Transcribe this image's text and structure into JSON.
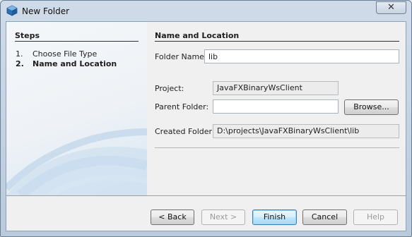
{
  "window": {
    "title": "New Folder",
    "close_glyph": "✕"
  },
  "steps": {
    "heading": "Steps",
    "items": [
      {
        "num": "1.",
        "label": "Choose File Type"
      },
      {
        "num": "2.",
        "label": "Name and Location"
      }
    ]
  },
  "form": {
    "heading": "Name and Location",
    "folder_name_label": "Folder Name:",
    "folder_name_value": "lib",
    "project_label": "Project:",
    "project_value": "JavaFXBinaryWsClient",
    "parent_folder_label": "Parent Folder:",
    "parent_folder_value": "",
    "browse_label": "Browse...",
    "created_folder_label": "Created Folder:",
    "created_folder_value": "D:\\projects\\JavaFXBinaryWsClient\\lib"
  },
  "buttons": {
    "back": "< Back",
    "next": "Next >",
    "finish": "Finish",
    "cancel": "Cancel",
    "help": "Help"
  },
  "icons": {
    "app": "netbeans-cube-icon",
    "close": "close-icon"
  }
}
